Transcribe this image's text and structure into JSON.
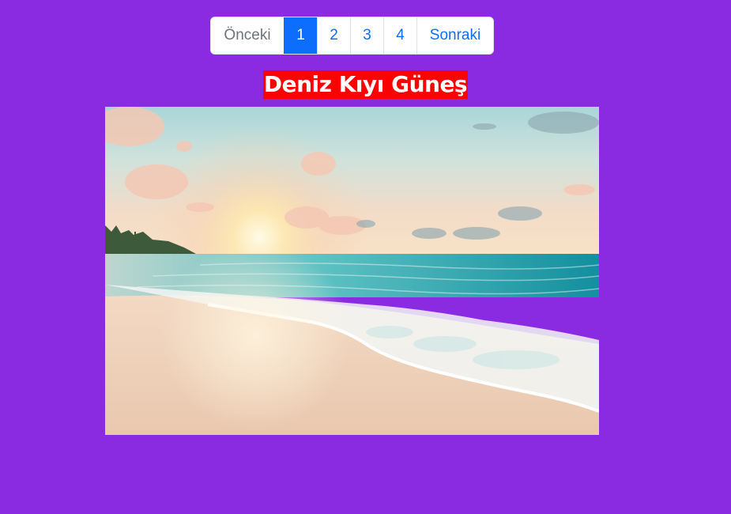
{
  "pagination": {
    "prev_label": "Önceki",
    "pages": [
      "1",
      "2",
      "3",
      "4"
    ],
    "active_page": "1",
    "next_label": "Sonraki"
  },
  "title": "Deniz Kıyı Güneş",
  "image": {
    "subject": "beach-sunset-photo"
  },
  "colors": {
    "background": "#8a2be2",
    "title_bg": "#ff0000",
    "active_page": "#0d6efd",
    "link": "#0d6efd"
  }
}
